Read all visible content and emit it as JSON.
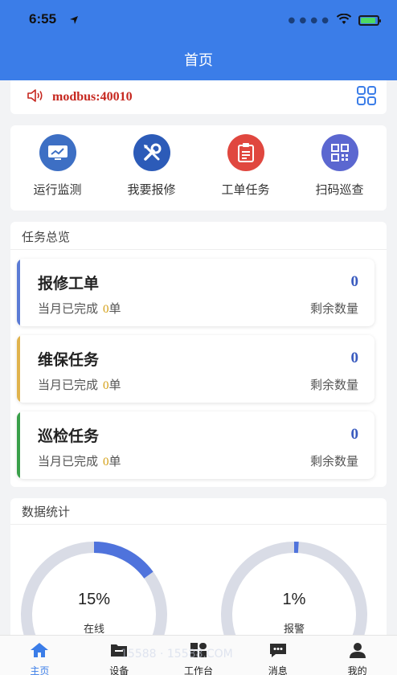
{
  "status": {
    "time": "6:55"
  },
  "nav": {
    "title": "首页"
  },
  "notice": {
    "text": "modbus:40010"
  },
  "quick": [
    {
      "label": "运行监测",
      "color": "#3d6fc4",
      "icon": "monitor-icon"
    },
    {
      "label": "我要报修",
      "color": "#2c5bb8",
      "icon": "tools-icon"
    },
    {
      "label": "工单任务",
      "color": "#e0473f",
      "icon": "clipboard-icon"
    },
    {
      "label": "扫码巡查",
      "color": "#5b67d0",
      "icon": "qrcode-icon"
    }
  ],
  "tasks": {
    "title": "任务总览",
    "items": [
      {
        "title": "报修工单",
        "count": "0",
        "done_prefix": "当月已完成",
        "done_value": "0",
        "done_unit": "单",
        "right": "剩余数量",
        "bar": "#5b7bd5"
      },
      {
        "title": "维保任务",
        "count": "0",
        "done_prefix": "当月已完成",
        "done_value": "0",
        "done_unit": "单",
        "right": "剩余数量",
        "bar": "#e0b34d"
      },
      {
        "title": "巡检任务",
        "count": "0",
        "done_prefix": "当月已完成",
        "done_value": "0",
        "done_unit": "单",
        "right": "剩余数量",
        "bar": "#3aa04a"
      }
    ]
  },
  "stats": {
    "title": "数据统计",
    "gauges": [
      {
        "percent": "15%",
        "fraction": 0.15,
        "label": "在线"
      },
      {
        "percent": "1%",
        "fraction": 0.01,
        "label": "报警"
      }
    ],
    "track_color": "#d9dce6",
    "fill_color": "#4f73dc"
  },
  "tabs": [
    {
      "label": "主页",
      "icon": "home-icon",
      "active": true
    },
    {
      "label": "设备",
      "icon": "device-icon",
      "active": false
    },
    {
      "label": "工作台",
      "icon": "workbench-icon",
      "active": false
    },
    {
      "label": "消息",
      "icon": "message-icon",
      "active": false
    },
    {
      "label": "我的",
      "icon": "profile-icon",
      "active": false
    }
  ],
  "watermark": "15588 · 15588.COM"
}
